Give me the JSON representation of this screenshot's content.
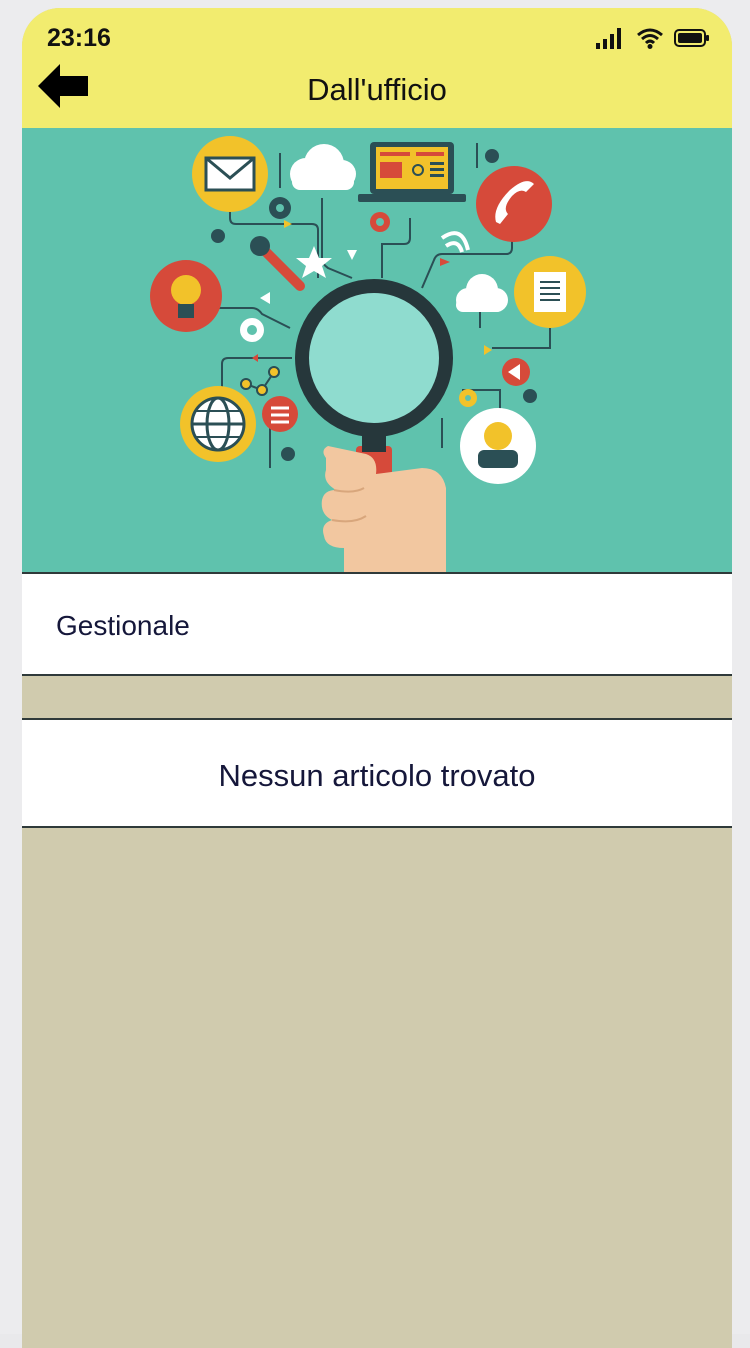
{
  "status_bar": {
    "time": "23:16"
  },
  "header": {
    "title": "Dall'ufficio"
  },
  "sections": [
    {
      "label": "Gestionale"
    }
  ],
  "empty_state": {
    "message": "Nessun articolo trovato"
  },
  "colors": {
    "header_bg": "#f2ec6f",
    "hero_bg": "#5fc2ad",
    "page_bg": "#d0cbae",
    "text": "#15173a"
  }
}
